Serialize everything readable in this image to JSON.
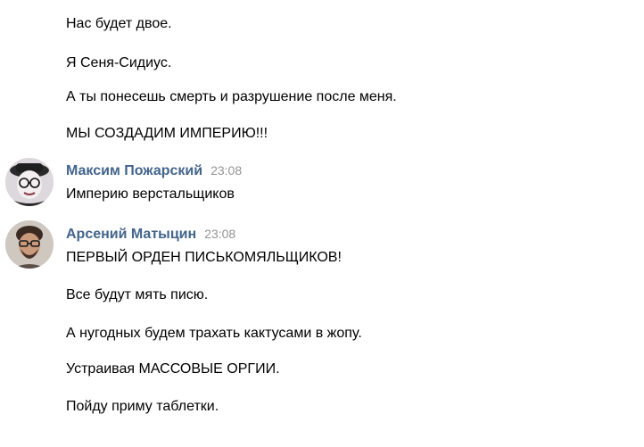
{
  "messages_before": [
    "Нас будет двое.",
    "Я Сеня-Сидиус.",
    "А ты понесешь смерть и разрушение после меня.",
    "МЫ СОЗДАДИМ ИМПЕРИЮ!!!"
  ],
  "post1": {
    "author": "Максим Пожарский",
    "time": "23:08",
    "text": "Империю верстальщиков"
  },
  "post2": {
    "author": "Арсений Матыцин",
    "time": "23:08",
    "lines": [
      "ПЕРВЫЙ ОРДЕН ПИСЬКОМЯЛЬЩИКОВ!",
      "Все будут мять писю.",
      "А нугодных будем трахать кактусами в жопу.",
      "Устраивая МАССОВЫЕ ОРГИИ.",
      "Пойду приму таблетки."
    ]
  },
  "colors": {
    "author_name": "#42648b",
    "time": "#939393",
    "text": "#000000"
  }
}
